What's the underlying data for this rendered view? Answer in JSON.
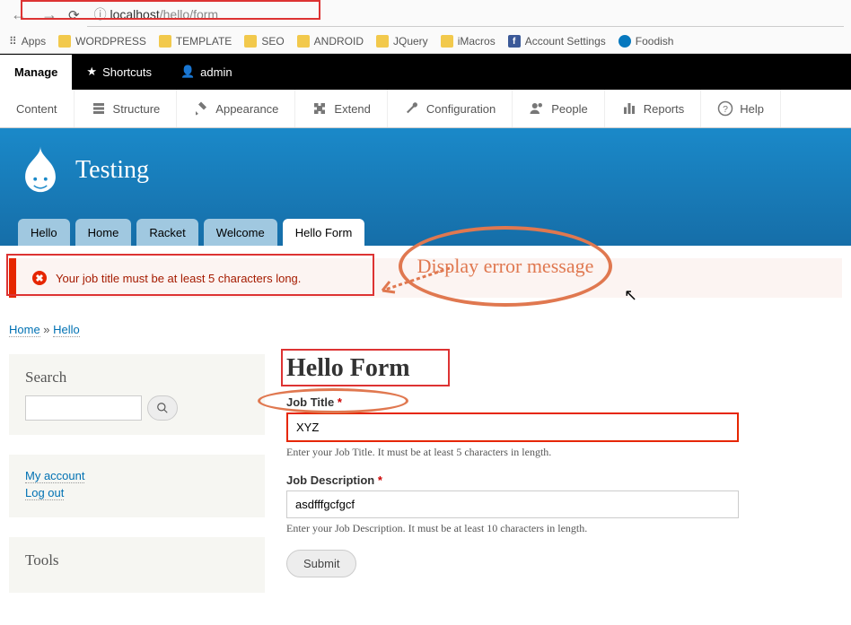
{
  "browser": {
    "url_prefix": "localhost",
    "url_path": "/hello/form",
    "bookmarks": {
      "apps": "Apps",
      "items": [
        "WORDPRESS",
        "TEMPLATE",
        "SEO",
        "ANDROID",
        "JQuery",
        "iMacros",
        "Account Settings",
        "Foodish"
      ]
    }
  },
  "toolbar": {
    "manage": "Manage",
    "shortcuts": "Shortcuts",
    "admin": "admin"
  },
  "admin_menu": [
    "Content",
    "Structure",
    "Appearance",
    "Extend",
    "Configuration",
    "People",
    "Reports",
    "Help"
  ],
  "site": {
    "name": "Testing"
  },
  "tabs": [
    "Hello",
    "Home",
    "Racket",
    "Welcome",
    "Hello Form"
  ],
  "active_tab": 4,
  "error_message": "Your job title must be at least 5 characters long.",
  "breadcrumb": [
    "Home",
    "Hello"
  ],
  "breadcrumb_sep": " » ",
  "sidebar": {
    "search": "Search",
    "user": [
      "My account",
      "Log out"
    ],
    "tools": "Tools"
  },
  "page_title": "Hello Form",
  "form": {
    "job_title": {
      "label": "Job Title",
      "value": "XYZ",
      "desc": "Enter your Job Title. It must be at least 5 characters in length."
    },
    "job_desc": {
      "label": "Job Description",
      "value": "asdfffgcfgcf",
      "desc": "Enter your Job Description. It must be at least 10 characters in length."
    },
    "submit": "Submit"
  },
  "annotation": {
    "callout": "Display error message"
  }
}
